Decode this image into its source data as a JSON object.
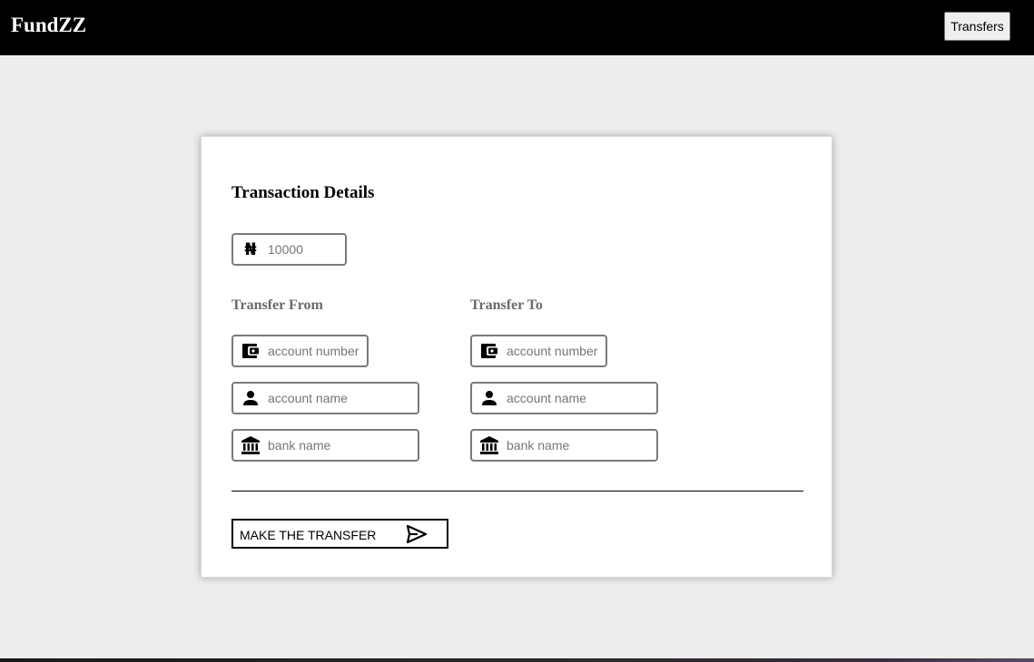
{
  "app": {
    "brand": "FundZZ",
    "nav_button_label": "Transfers"
  },
  "form": {
    "title": "Transaction Details",
    "amount": {
      "currency_icon": "naira-icon",
      "currency_symbol": "₦",
      "placeholder": "10000",
      "value": ""
    },
    "from": {
      "label": "Transfer From",
      "account_number_placeholder": "account number",
      "account_name_placeholder": "account name",
      "bank_name_placeholder": "bank name"
    },
    "to": {
      "label": "Transfer To",
      "account_number_placeholder": "account number",
      "account_name_placeholder": "account name",
      "bank_name_placeholder": "bank name"
    },
    "submit_label": "MAKE THE TRANSFER",
    "submit_icon": "send-icon"
  },
  "colors": {
    "navbar": "#000000",
    "page_background": "#ededed",
    "card_background": "#ffffff",
    "field_border": "#7a7a7a",
    "section_label": "#6a6a6a"
  }
}
